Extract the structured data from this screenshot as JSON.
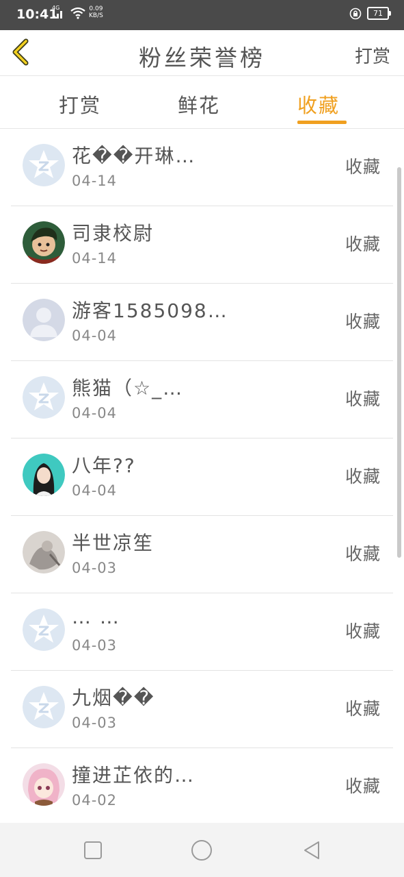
{
  "status_bar": {
    "time": "10:41",
    "network": "4G",
    "speed_value": "0.09",
    "speed_unit": "KB/S",
    "battery": "71"
  },
  "header": {
    "title": "粉丝荣誉榜",
    "right_link": "打赏"
  },
  "tabs": [
    {
      "label": "打赏",
      "active": false
    },
    {
      "label": "鲜花",
      "active": false
    },
    {
      "label": "收藏",
      "active": true
    }
  ],
  "accent_color": "#f0a020",
  "fans": [
    {
      "name": "花��开琳…",
      "date": "04-14",
      "action": "收藏",
      "avatar": "default-star"
    },
    {
      "name": "司隶校尉",
      "date": "04-14",
      "action": "收藏",
      "avatar": "warrior"
    },
    {
      "name": "游客1585098…",
      "date": "04-04",
      "action": "收藏",
      "avatar": "silhouette"
    },
    {
      "name": "熊猫（☆_…",
      "date": "04-04",
      "action": "收藏",
      "avatar": "default-star"
    },
    {
      "name": "八年??",
      "date": "04-04",
      "action": "收藏",
      "avatar": "girl-photo"
    },
    {
      "name": "半世凉笙",
      "date": "04-03",
      "action": "收藏",
      "avatar": "grey-photo"
    },
    {
      "name": "… …",
      "date": "04-03",
      "action": "收藏",
      "avatar": "default-star"
    },
    {
      "name": "九烟��",
      "date": "04-03",
      "action": "收藏",
      "avatar": "default-star"
    },
    {
      "name": "撞进芷依的…",
      "date": "04-02",
      "action": "收藏",
      "avatar": "anime-girl"
    }
  ]
}
